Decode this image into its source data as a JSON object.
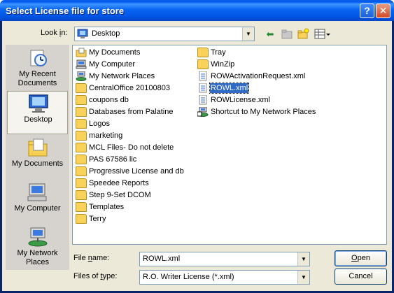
{
  "window": {
    "title": "Select License file for store"
  },
  "lookin": {
    "label_pre": "Look ",
    "label_u": "i",
    "label_post": "n:",
    "value": "Desktop"
  },
  "places": [
    {
      "name": "place-my-recent-documents",
      "label": "My Recent Documents",
      "icon": "recent-documents-icon",
      "selected": false
    },
    {
      "name": "place-desktop",
      "label": "Desktop",
      "icon": "desktop-icon",
      "selected": true
    },
    {
      "name": "place-my-documents",
      "label": "My Documents",
      "icon": "my-documents-icon",
      "selected": false
    },
    {
      "name": "place-my-computer",
      "label": "My Computer",
      "icon": "my-computer-icon",
      "selected": false
    },
    {
      "name": "place-my-network-places",
      "label": "My Network Places",
      "icon": "network-places-icon",
      "selected": false
    }
  ],
  "files": {
    "column1": [
      {
        "label": "My Documents",
        "icon": "my-documents-icon"
      },
      {
        "label": "My Computer",
        "icon": "computer-icon"
      },
      {
        "label": "My Network Places",
        "icon": "network-icon"
      },
      {
        "label": "CentralOffice 20100803",
        "icon": "folder-icon"
      },
      {
        "label": "coupons db",
        "icon": "folder-icon"
      },
      {
        "label": "Databases from Palatine",
        "icon": "folder-icon"
      },
      {
        "label": "Logos",
        "icon": "folder-icon"
      },
      {
        "label": "marketing",
        "icon": "folder-icon"
      },
      {
        "label": "MCL Files- Do not delete",
        "icon": "folder-icon"
      },
      {
        "label": "PAS 67586 lic",
        "icon": "folder-icon"
      },
      {
        "label": "Progressive License and db",
        "icon": "folder-icon"
      },
      {
        "label": "Speedee Reports",
        "icon": "folder-icon"
      },
      {
        "label": "Step 9-Set DCOM",
        "icon": "folder-icon"
      },
      {
        "label": "Templates",
        "icon": "folder-icon"
      },
      {
        "label": "Terry",
        "icon": "folder-icon"
      }
    ],
    "column2": [
      {
        "label": "Tray",
        "icon": "folder-icon",
        "selected": false
      },
      {
        "label": "WinZip",
        "icon": "folder-icon",
        "selected": false
      },
      {
        "label": "ROWActivationRequest.xml",
        "icon": "xml-file-icon",
        "selected": false
      },
      {
        "label": "ROWL.xml",
        "icon": "xml-file-icon",
        "selected": true
      },
      {
        "label": "ROWLicense.xml",
        "icon": "xml-file-icon",
        "selected": false
      },
      {
        "label": "Shortcut to My Network Places",
        "icon": "shortcut-icon",
        "selected": false
      }
    ]
  },
  "filename": {
    "label_pre": "File ",
    "label_u": "n",
    "label_post": "ame:",
    "value": "ROWL.xml"
  },
  "filetype": {
    "label_pre": "Files of ",
    "label_u": "t",
    "label_post": "ype:",
    "value": "R.O. Writer License (*.xml)"
  },
  "buttons": {
    "open_u": "O",
    "open_rest": "pen",
    "cancel": "Cancel"
  },
  "titlebar": {
    "help": "?",
    "close": "✕"
  }
}
